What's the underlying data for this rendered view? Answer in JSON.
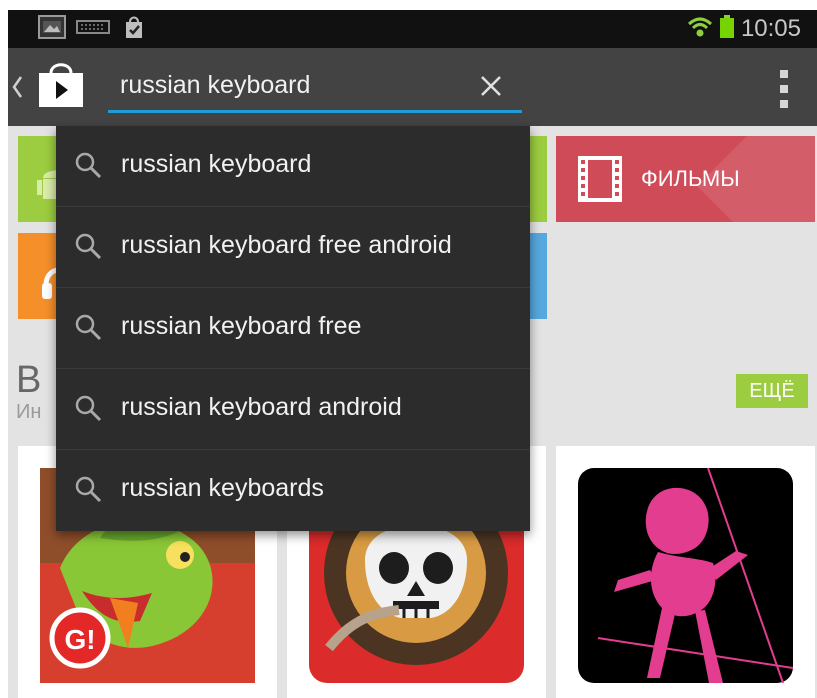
{
  "status_bar": {
    "time": "10:05",
    "left_icons": [
      "image-icon",
      "keyboard-icon",
      "play-store-bag-icon"
    ],
    "right_icons": [
      "wifi-icon",
      "battery-icon"
    ]
  },
  "action_bar": {
    "back_icon": "back-chevron-icon",
    "app_icon": "play-store-bag-icon",
    "search": {
      "value": "russian keyboard",
      "placeholder": ""
    },
    "clear_icon": "close-icon",
    "overflow_icon": "overflow-menu-icon"
  },
  "suggestions": [
    {
      "label": "russian keyboard",
      "icon": "search-icon"
    },
    {
      "label": "russian keyboard free android",
      "icon": "search-icon"
    },
    {
      "label": "russian keyboard free",
      "icon": "search-icon"
    },
    {
      "label": "russian keyboard android",
      "icon": "search-icon"
    },
    {
      "label": "russian keyboards",
      "icon": "search-icon"
    }
  ],
  "content": {
    "category_tiles": {
      "movies_label": "ФИЛЬМЫ",
      "colors": {
        "green": "#9ccc3f",
        "orange": "#f58f2a",
        "red": "#cf4b57",
        "blue": "#56a8df"
      }
    },
    "section": {
      "title": "В",
      "subtitle": "Ин",
      "more_label": "ЕЩЁ"
    },
    "cards": [
      {
        "icon": "dragon-game-icon"
      },
      {
        "icon": "skull-pirate-icon"
      },
      {
        "icon": "pink-silhouette-icon"
      }
    ]
  },
  "colors": {
    "status_bar": "#111111",
    "action_bar": "#434343",
    "dropdown": "#2c2c2c",
    "accent": "#1f9bd6",
    "text_light": "#f1f1f1",
    "background": "#e3e3e3"
  }
}
